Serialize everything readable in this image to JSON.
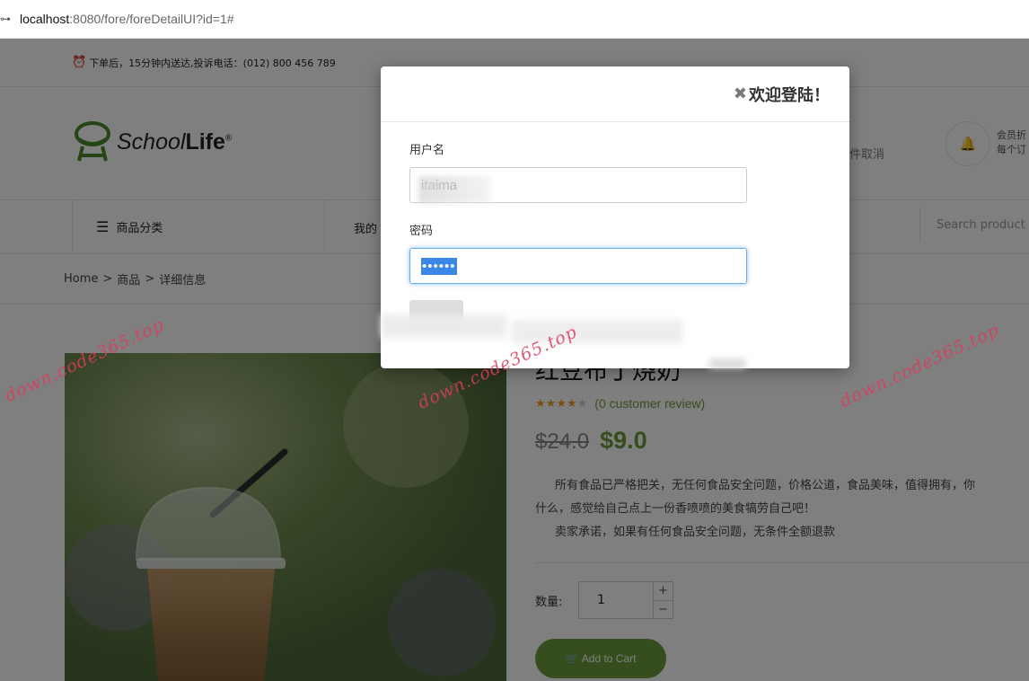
{
  "browser": {
    "url_host": "localhost",
    "url_rest": ":8080/fore/foreDetailUI?id=1#"
  },
  "topbar": {
    "notice": "下单后，15分钟内送达,投诉电话：(012) 800 456 789"
  },
  "header": {
    "logo_school": "School",
    "logo_life": "Life",
    "logo_reg": "®",
    "note": "件取消",
    "member_line1": "会员折",
    "member_line2": "每个订"
  },
  "nav": {
    "category": "商品分类",
    "mine": "我的",
    "search_placeholder": "Search product"
  },
  "breadcrumb": {
    "home": "Home",
    "sep": ">",
    "products": "商品",
    "detail": "详细信息"
  },
  "product": {
    "title": "红豆布丁烧奶",
    "rating": 4,
    "rating_max": 5,
    "review_text": "(0 customer review)",
    "old_price": "$24.0",
    "new_price": "$9.0",
    "desc_1": "所有食品已严格把关，无任何食品安全问题，价格公道，食品美味，值得拥有，你",
    "desc_2": "什么，感觉给自己点上一份香喷喷的美食犒劳自己吧！",
    "desc_3": "卖家承诺，如果有任何食品安全问题，无条件全额退款",
    "qty_label": "数量:",
    "qty_value": "1",
    "qty_plus": "+",
    "qty_minus": "−",
    "add_to_cart": "Add to Cart"
  },
  "login_modal": {
    "close": "✖",
    "title": "欢迎登陆！",
    "username_label": "用户名",
    "username_value": "itaima",
    "password_label": "密码",
    "password_value": "••••••"
  },
  "watermarks": [
    "down.code365.top",
    "down.code365.top",
    "down.code365.top"
  ],
  "colors": {
    "accent": "#6c9a3a",
    "watermark": "#dc3c5a",
    "selection": "#3b87e6"
  }
}
